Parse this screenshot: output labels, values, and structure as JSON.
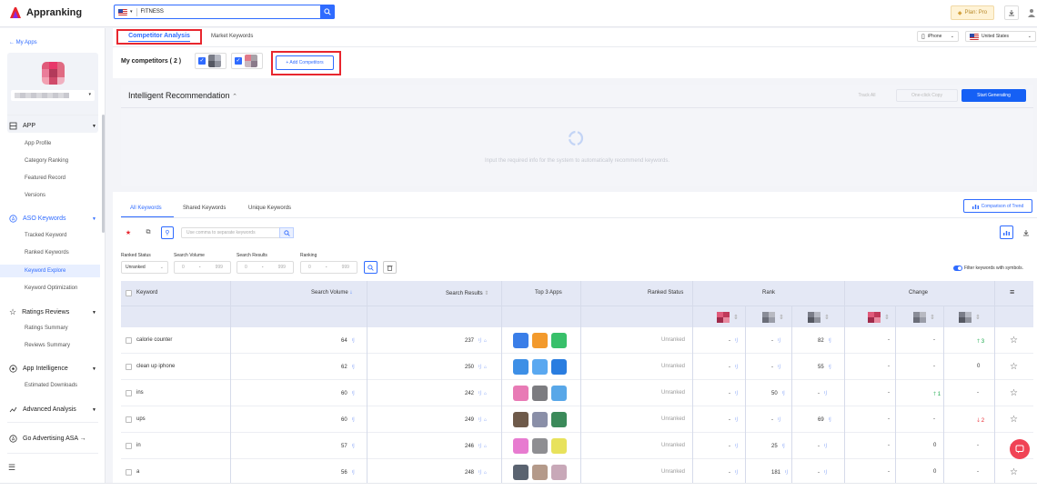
{
  "brand": {
    "name": "Appranking",
    "colors": {
      "accent": "#2f6bff",
      "highlight": "#e8262e"
    }
  },
  "search": {
    "country_icon": "us-flag-icon",
    "value": "FITNESS"
  },
  "topbar": {
    "plan_label": "Plan: Pro"
  },
  "sidebar": {
    "back": "My Apps",
    "groups": [
      {
        "label": "APP",
        "icon": "grid-icon",
        "items": [
          "App Profile",
          "Category Ranking",
          "Featured Record",
          "Versions"
        ]
      },
      {
        "label": "ASO Keywords",
        "icon": "aso-icon",
        "items": [
          "Tracked Keyword",
          "Ranked Keywords",
          "Keyword Explore",
          "Keyword Optimization"
        ],
        "active_item": "Keyword Explore"
      },
      {
        "label": "Ratings Reviews",
        "icon": "star-icon",
        "items": [
          "Ratings Summary",
          "Reviews Summary"
        ]
      },
      {
        "label": "App Intelligence",
        "icon": "bulb-icon",
        "items": [
          "Estimated Downloads"
        ]
      },
      {
        "label": "Advanced Analysis",
        "icon": "analysis-icon",
        "items": []
      }
    ],
    "go_asa": "Go Advertising ASA →"
  },
  "tabs": {
    "competitor": "Competitor Analysis",
    "market": "Market Keywords"
  },
  "device": {
    "device": "iPhone",
    "country": "United States"
  },
  "competitors": {
    "label": "My competitors ( 2 )",
    "add": "+ Add Competitors"
  },
  "recommend": {
    "title": "Intelligent Recommendation",
    "track_all": "Track All",
    "copy": "One-click Copy",
    "generate": "Start Generating",
    "hint": "Input the required info for the system to automatically recommend keywords."
  },
  "kw_tabs": [
    "All Keywords",
    "Shared Keywords",
    "Unique Keywords"
  ],
  "compare_trend": "Comparison of Trend",
  "sep_placeholder": "Use comma to separate keywords",
  "filters": {
    "ranked_status": {
      "label": "Ranked Status",
      "value": "Unranked"
    },
    "search_volume": {
      "label": "Search Volume",
      "min": "0",
      "dash": "-",
      "max": "999"
    },
    "search_results": {
      "label": "Search Results",
      "min": "0",
      "dash": "-",
      "max": "999"
    },
    "ranking": {
      "label": "Ranking",
      "min": "0",
      "dash": "-",
      "max": "999"
    },
    "symbols_label": "Filter keywords with symbols."
  },
  "table": {
    "headers": {
      "keyword": "Keyword",
      "search_volume": "Search Volume",
      "search_results": "Search Results",
      "top3": "Top 3 Apps",
      "ranked_status": "Ranked Status",
      "rank": "Rank",
      "change": "Change"
    },
    "rows": [
      {
        "keyword": "calorie counter",
        "volume": "64",
        "results": "237",
        "status": "Unranked",
        "r1": "-",
        "r2": "-",
        "r3": "82",
        "c1": "-",
        "c2": "-",
        "c3": "3",
        "c3dir": "up",
        "apps": [
          "#3a7ee8",
          "#f39a2c",
          "#38c06a"
        ]
      },
      {
        "keyword": "clean up iphone",
        "volume": "62",
        "results": "250",
        "status": "Unranked",
        "r1": "-",
        "r2": "-",
        "r3": "55",
        "c1": "-",
        "c2": "-",
        "c3": "0",
        "c3dir": "",
        "apps": [
          "#3d8fe6",
          "#5aa8f0",
          "#2a7de0"
        ]
      },
      {
        "keyword": "ins",
        "volume": "60",
        "results": "242",
        "status": "Unranked",
        "r1": "-",
        "r2": "50",
        "r3": "-",
        "c1": "-",
        "c2": "1",
        "c2dir": "up",
        "c3": "-",
        "c3dir": "",
        "apps": [
          "#e87ab5",
          "#7c7c80",
          "#58a7e8"
        ]
      },
      {
        "keyword": "ups",
        "volume": "60",
        "results": "249",
        "status": "Unranked",
        "r1": "-",
        "r2": "-",
        "r3": "69",
        "c1": "-",
        "c2": "-",
        "c3": "2",
        "c3dir": "down",
        "apps": [
          "#6e5a4a",
          "#8a8fa8",
          "#3b8a5a"
        ]
      },
      {
        "keyword": "in",
        "volume": "57",
        "results": "246",
        "status": "Unranked",
        "r1": "-",
        "r2": "25",
        "r3": "-",
        "c1": "-",
        "c2": "0",
        "c3": "-",
        "c3dir": "",
        "apps": [
          "#e77bd0",
          "#8e8e92",
          "#e8e25c"
        ]
      },
      {
        "keyword": "a",
        "volume": "56",
        "results": "248",
        "status": "Unranked",
        "r1": "-",
        "r2": "181",
        "r3": "-",
        "c1": "-",
        "c2": "0",
        "c3": "-",
        "c3dir": "",
        "apps": [
          "#5a6370",
          "#b49a8a",
          "#c8a8b8"
        ]
      }
    ]
  }
}
